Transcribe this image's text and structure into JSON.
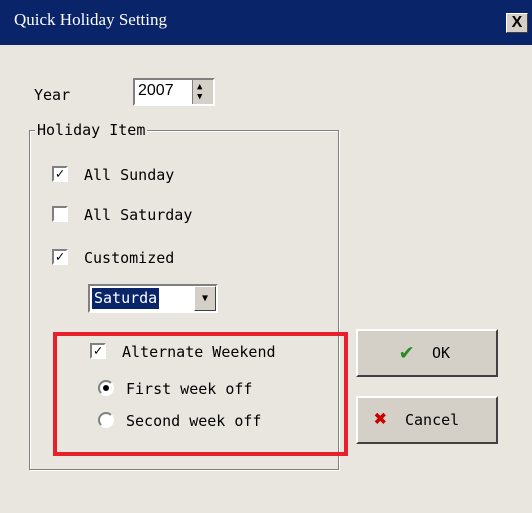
{
  "window": {
    "title": "Quick Holiday Setting",
    "close_glyph": "X"
  },
  "year": {
    "label": "Year",
    "value": "2007"
  },
  "holiday_item": {
    "title": "Holiday Item",
    "all_sunday": {
      "label": "All Sunday",
      "checked": true
    },
    "all_saturday": {
      "label": "All Saturday",
      "checked": false
    },
    "customized": {
      "label": "Customized",
      "checked": true
    },
    "day_select": {
      "value": "Saturda"
    },
    "alternate_weekend": {
      "label": "Alternate Weekend",
      "checked": true
    },
    "first_week_off": {
      "label": "First week off",
      "selected": true
    },
    "second_week_off": {
      "label": "Second week off",
      "selected": false
    }
  },
  "buttons": {
    "ok": {
      "label": "OK",
      "icon": "checkmark-icon",
      "color": "#2a8a2a"
    },
    "cancel": {
      "label": "Cancel",
      "icon": "x-icon",
      "color": "#cc0000"
    }
  },
  "highlight_color": "#e8202a"
}
